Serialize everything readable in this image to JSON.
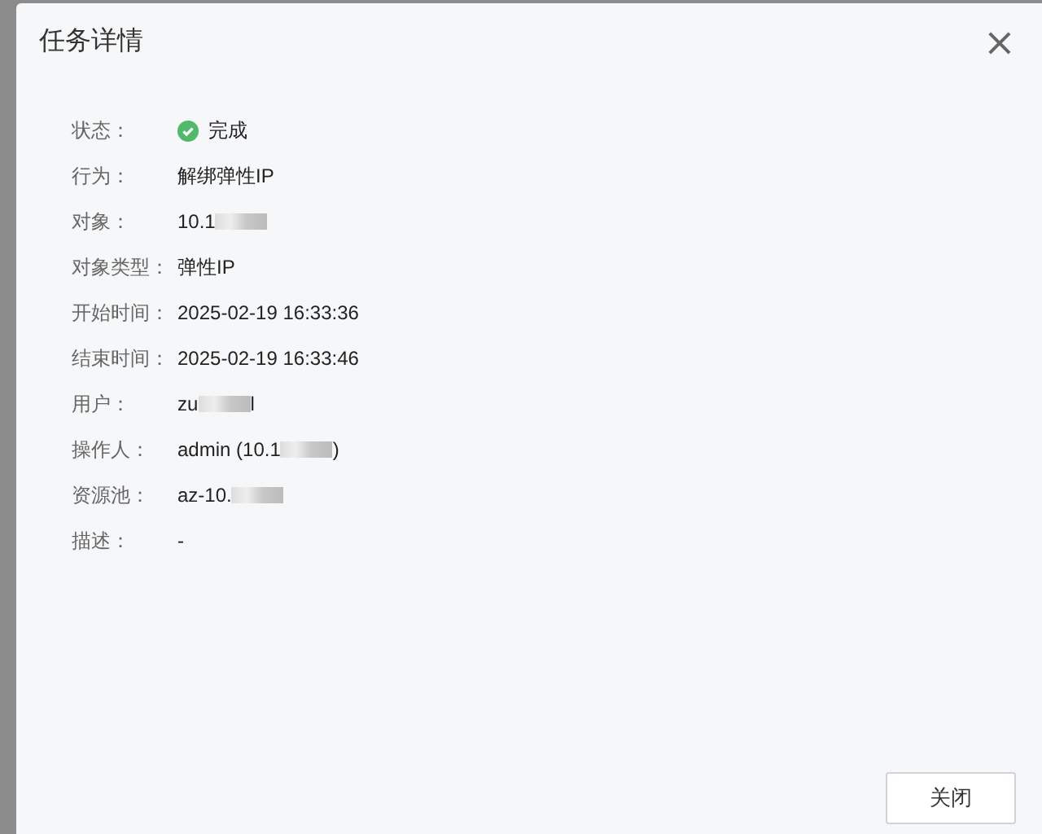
{
  "dialog": {
    "title": "任务详情",
    "close": "×",
    "fields": [
      {
        "label": "状态：",
        "success": true,
        "parts": [
          {
            "kind": "text",
            "text": "完成"
          }
        ]
      },
      {
        "label": "行为：",
        "parts": [
          {
            "kind": "text",
            "text": "解绑弹性IP"
          }
        ]
      },
      {
        "label": "对象：",
        "parts": [
          {
            "kind": "text",
            "text": "10.1"
          },
          {
            "kind": "redacted"
          }
        ]
      },
      {
        "label": "对象类型：",
        "parts": [
          {
            "kind": "text",
            "text": "弹性IP"
          }
        ]
      },
      {
        "label": "开始时间：",
        "parts": [
          {
            "kind": "text",
            "text": "2025-02-19 16:33:36"
          }
        ]
      },
      {
        "label": "结束时间：",
        "parts": [
          {
            "kind": "text",
            "text": "2025-02-19 16:33:46"
          }
        ]
      },
      {
        "label": "用户：",
        "parts": [
          {
            "kind": "text",
            "text": "zu"
          },
          {
            "kind": "redacted"
          },
          {
            "kind": "text",
            "text": "l"
          }
        ]
      },
      {
        "label": "操作人：",
        "parts": [
          {
            "kind": "text",
            "text": "admin (10.1"
          },
          {
            "kind": "redacted"
          },
          {
            "kind": "text",
            "text": ")"
          }
        ]
      },
      {
        "label": "资源池：",
        "parts": [
          {
            "kind": "text",
            "text": "az-10."
          },
          {
            "kind": "redacted"
          }
        ]
      },
      {
        "label": "描述：",
        "parts": [
          {
            "kind": "text",
            "text": "-"
          }
        ]
      }
    ],
    "button": "关闭"
  }
}
